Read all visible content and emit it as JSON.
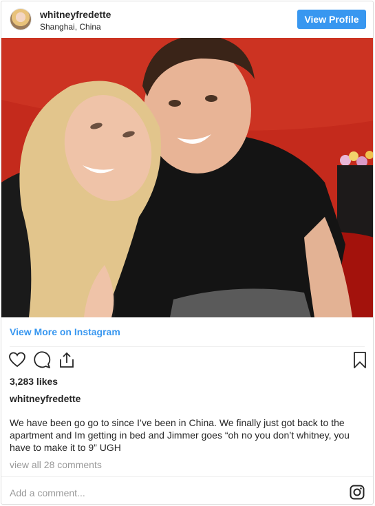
{
  "header": {
    "username": "whitneyfredette",
    "location": "Shanghai, China",
    "view_profile_label": "View Profile"
  },
  "post": {
    "view_more_label": "View More on Instagram",
    "likes": "3,283 likes",
    "caption_user": "whitneyfredette",
    "caption_text": "We have been go go to since I’ve been in China. We finally just got back to the apartment and Im getting in bed and Jimmer goes “oh no you don’t whitney, you have to make it to 9” UGH",
    "comments_link": "view all 28 comments",
    "add_comment_placeholder": "Add a comment..."
  },
  "colors": {
    "accent": "#3897f0",
    "muted_text": "#999999",
    "text": "#262626"
  },
  "icons": {
    "like": "heart-icon",
    "comment": "comment-icon",
    "share": "share-icon",
    "save": "bookmark-icon",
    "instagram": "instagram-icon"
  }
}
